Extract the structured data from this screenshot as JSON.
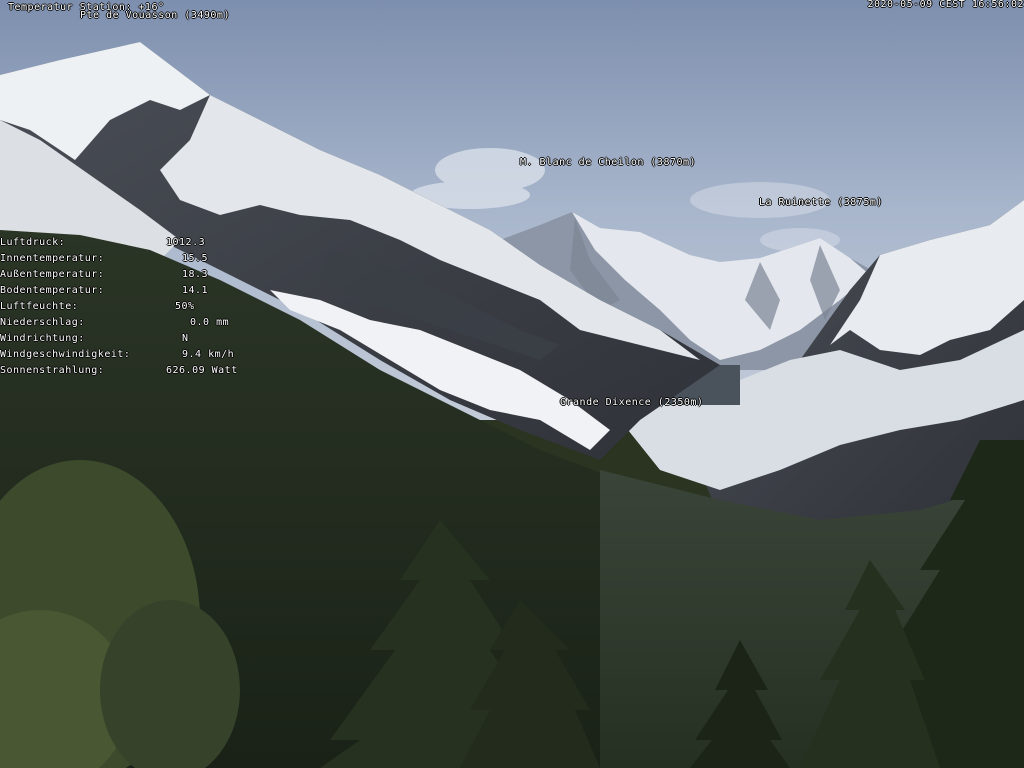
{
  "overlay": {
    "station_temperature": "Temperatur Station: +16°",
    "peak_top": "Pte de Vouasson (3490m)",
    "timestamp": "2020-05-09 CEST 16:56:02",
    "peak_blanc": "M. Blanc de Cheilon (3870m)",
    "peak_ruinette": "La Ruinette (3875m)",
    "dam": "Grande Dixence (2350m)"
  },
  "weather": [
    {
      "label": "Luftdruck:",
      "value": "1012.3"
    },
    {
      "label": "Innentemperatur:",
      "value": "15.5"
    },
    {
      "label": "Außentemperatur:",
      "value": "18.3"
    },
    {
      "label": "Bodentemperatur:",
      "value": "14.1"
    },
    {
      "label": "Luftfeuchte:",
      "value": "50%"
    },
    {
      "label": "Niederschlag:",
      "value": "0.0 mm"
    },
    {
      "label": "Windrichtung:",
      "value": "N"
    },
    {
      "label": "Windgeschwindigkeit:",
      "value": "9.4 km/h"
    },
    {
      "label": "Sonnenstrahlung:",
      "value": "626.09 Watt"
    }
  ]
}
